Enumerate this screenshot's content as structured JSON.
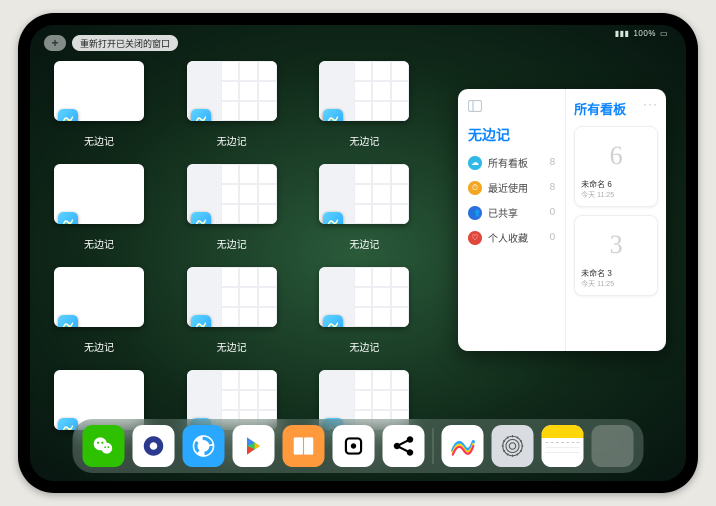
{
  "status": {
    "battery": "100%",
    "signal": "•••"
  },
  "top": {
    "plus": "+",
    "reopen_label": "重新打开已关闭的窗口"
  },
  "app_label": "无边记",
  "thumbs": [
    {
      "style": "blank"
    },
    {
      "style": "content"
    },
    {
      "style": "content"
    },
    {
      "style": "blank"
    },
    {
      "style": "content"
    },
    {
      "style": "content"
    },
    {
      "style": "blank"
    },
    {
      "style": "content"
    },
    {
      "style": "content"
    },
    {
      "style": "blank"
    },
    {
      "style": "content"
    },
    {
      "style": "content"
    }
  ],
  "spotlight": {
    "left_title": "无边记",
    "right_title": "所有看板",
    "dots": "···",
    "items": [
      {
        "icon": "☁",
        "color": "#2eb9e6",
        "label": "所有看板",
        "count": "8"
      },
      {
        "icon": "⏱",
        "color": "#f5a623",
        "label": "最近使用",
        "count": "8"
      },
      {
        "icon": "👥",
        "color": "#2d6fe0",
        "label": "已共享",
        "count": "0"
      },
      {
        "icon": "♡",
        "color": "#e0483e",
        "label": "个人收藏",
        "count": "0"
      }
    ],
    "cards": [
      {
        "glyph": "6",
        "name": "未命名 6",
        "time": "今天 11:25"
      },
      {
        "glyph": "3",
        "name": "未命名 3",
        "time": "今天 11:25"
      }
    ]
  },
  "dock": {
    "apps": [
      {
        "name": "wechat",
        "bg": "#2dc100"
      },
      {
        "name": "quark",
        "bg": "#ffffff"
      },
      {
        "name": "qqbrowser",
        "bg": "#2aa8ff"
      },
      {
        "name": "play",
        "bg": "#ffffff"
      },
      {
        "name": "books",
        "bg": "#ff9a3c"
      },
      {
        "name": "dice",
        "bg": "#ffffff"
      },
      {
        "name": "share",
        "bg": "#ffffff"
      }
    ],
    "recent": [
      {
        "name": "freeform",
        "bg": "#ffffff"
      },
      {
        "name": "settings",
        "bg": "#d9dde1"
      },
      {
        "name": "notes",
        "bg": "#ffffff"
      }
    ],
    "folder": [
      "#3fc1ff",
      "#8e8e93",
      "#ff6b5b",
      "#0a84ff"
    ]
  }
}
